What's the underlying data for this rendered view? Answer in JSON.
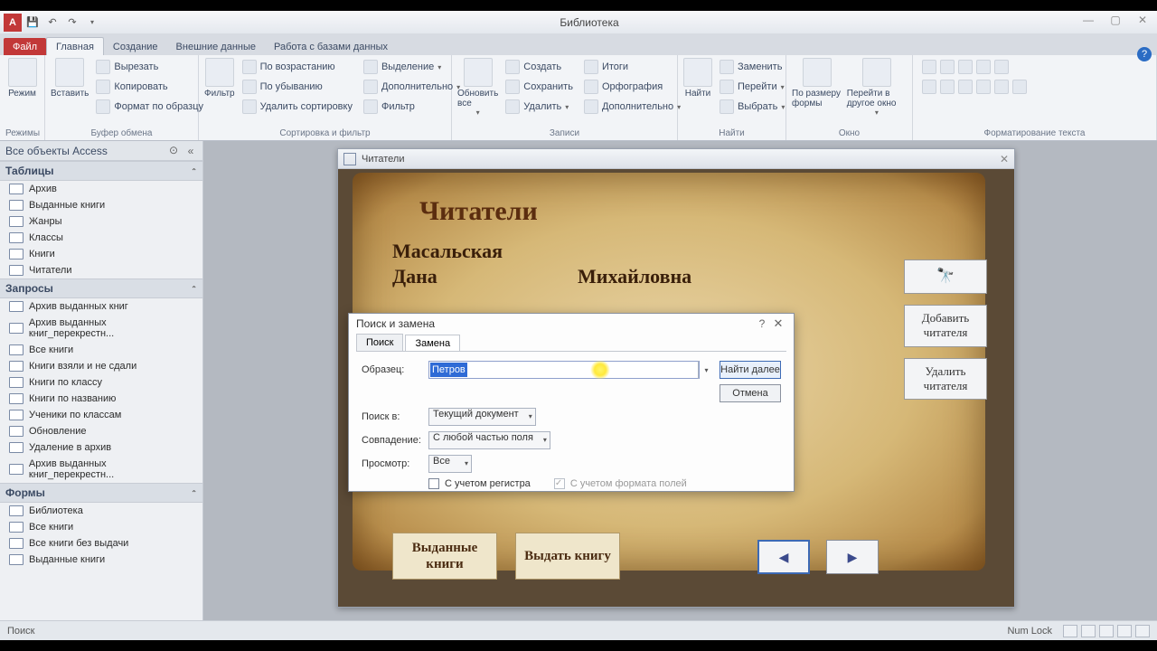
{
  "app_title": "Библиотека",
  "tabs": {
    "file": "Файл",
    "home": "Главная",
    "create": "Создание",
    "external": "Внешние данные",
    "dbtools": "Работа с базами данных"
  },
  "ribbon": {
    "views": {
      "label": "Режимы",
      "btn": "Режим"
    },
    "clipboard": {
      "label": "Буфер обмена",
      "paste": "Вставить",
      "cut": "Вырезать",
      "copy": "Копировать",
      "fmt": "Формат по образцу"
    },
    "sort": {
      "label": "Сортировка и фильтр",
      "filter": "Фильтр",
      "asc": "По возрастанию",
      "desc": "По убыванию",
      "clear": "Удалить сортировку",
      "sel": "Выделение",
      "adv": "Дополнительно",
      "toggle": "Фильтр"
    },
    "records": {
      "label": "Записи",
      "refresh": "Обновить все",
      "new": "Создать",
      "save": "Сохранить",
      "delete": "Удалить",
      "totals": "Итоги",
      "spell": "Орфография",
      "more": "Дополнительно"
    },
    "find": {
      "label": "Найти",
      "find": "Найти",
      "replace": "Заменить",
      "goto": "Перейти",
      "select": "Выбрать"
    },
    "window": {
      "label": "Окно",
      "fit": "По размеру формы",
      "other": "Перейти в другое окно"
    },
    "textfmt": {
      "label": "Форматирование текста"
    }
  },
  "nav": {
    "header": "Все объекты Access",
    "groups": [
      {
        "title": "Таблицы",
        "items": [
          "Архив",
          "Выданные книги",
          "Жанры",
          "Классы",
          "Книги",
          "Читатели"
        ]
      },
      {
        "title": "Запросы",
        "items": [
          "Архив выданных книг",
          "Архив выданных книг_перекрестн...",
          "Все книги",
          "Книги взяли и не сдали",
          "Книги по классу",
          "Книги по названию",
          "Ученики по классам",
          "Обновление",
          "Удаление в архив",
          "Архив выданных книг_перекрестн..."
        ]
      },
      {
        "title": "Формы",
        "items": [
          "Библиотека",
          "Все книги",
          "Все книги без выдачи",
          "Выданные книги"
        ]
      }
    ]
  },
  "form": {
    "title": "Читатели",
    "heading": "Читатели",
    "surname": "Масальская",
    "firstname": "Дана",
    "patronymic": "Михайловна",
    "btn_add": "Добавить читателя",
    "btn_del": "Удалить читателя",
    "btn_issued": "Выданные книги",
    "btn_issue": "Выдать книгу"
  },
  "dialog": {
    "title": "Поиск и замена",
    "tab_find": "Поиск",
    "tab_replace": "Замена",
    "lbl_sample": "Образец:",
    "value_sample": "Петров",
    "lbl_in": "Поиск в:",
    "val_in": "Текущий документ",
    "lbl_match": "Совпадение:",
    "val_match": "С любой частью поля",
    "lbl_view": "Просмотр:",
    "val_view": "Все",
    "chk_case": "С учетом регистра",
    "chk_fmt": "С учетом формата полей",
    "btn_next": "Найти далее",
    "btn_cancel": "Отмена"
  },
  "status": {
    "left": "Поиск",
    "numlock": "Num Lock"
  }
}
